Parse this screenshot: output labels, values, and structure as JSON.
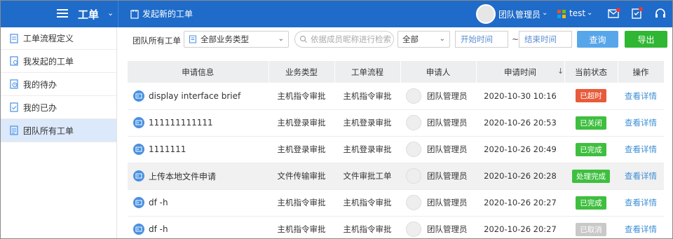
{
  "topbar": {
    "title": "工单",
    "new_ticket": "发起新的工单",
    "user_name": "团队管理员",
    "tenant_name": "test"
  },
  "colors": {
    "brand": "#1f6bc9",
    "active_side": "#dbe9fa",
    "query_button": "#58a6ea",
    "export_button": "#2fb733",
    "overtime": "#e85b3a",
    "done": "#3fbf3f",
    "cancelled": "#c9c9c9"
  },
  "sidebar": {
    "items": [
      {
        "label": "工单流程定义",
        "icon": "flow-definition-icon"
      },
      {
        "label": "我发起的工单",
        "icon": "my-ticket-icon"
      },
      {
        "label": "我的待办",
        "icon": "clock-icon"
      },
      {
        "label": "我的已办",
        "icon": "check-list-icon"
      },
      {
        "label": "团队所有工单",
        "icon": "team-ticket-icon"
      }
    ]
  },
  "filter": {
    "label": "团队所有工单",
    "business_type": "全部业务类型",
    "search_placeholder": "依据成员昵称进行检索",
    "status": "全部",
    "start_placeholder": "开始时间",
    "tilde": "~",
    "end_placeholder": "结束时间",
    "query_label": "查询",
    "export_label": "导出"
  },
  "table": {
    "headers": [
      "申请信息",
      "业务类型",
      "工单流程",
      "申请人",
      "申请时间",
      "当前状态",
      "操作"
    ],
    "sort_arrow": "↓",
    "rows": [
      {
        "info": "display interface brief",
        "type": "主机指令审批",
        "flow": "主机指令审批",
        "applicant": "团队管理员",
        "time": "2020-10-30 10:16",
        "status": "已超时",
        "status_color": "#e85b3a",
        "action": "查看详情",
        "icon": "terminal-icon"
      },
      {
        "info": "111111111111",
        "type": "主机登录审批",
        "flow": "主机登录审批",
        "applicant": "团队管理员",
        "time": "2020-10-26 20:53",
        "status": "已关闭",
        "status_color": "#3fbf3f",
        "action": "查看详情",
        "icon": "login-icon"
      },
      {
        "info": "1111111",
        "type": "主机登录审批",
        "flow": "主机登录审批",
        "applicant": "团队管理员",
        "time": "2020-10-26 20:49",
        "status": "已完成",
        "status_color": "#3fbf3f",
        "action": "查看详情",
        "icon": "login-icon"
      },
      {
        "info": "上传本地文件申请",
        "type": "文件传输审批",
        "flow": "文件审批工单",
        "applicant": "团队管理员",
        "time": "2020-10-26 20:28",
        "status": "处理完成",
        "status_color": "#3fbf3f",
        "action": "查看详情",
        "icon": "file-icon"
      },
      {
        "info": "df -h",
        "type": "主机指令审批",
        "flow": "主机指令审批",
        "applicant": "团队管理员",
        "time": "2020-10-26 20:27",
        "status": "已完成",
        "status_color": "#3fbf3f",
        "action": "查看详情",
        "icon": "terminal-icon"
      },
      {
        "info": "df -h",
        "type": "主机指令审批",
        "flow": "主机指令审批",
        "applicant": "团队管理员",
        "time": "2020-10-26 20:27",
        "status": "已取消",
        "status_color": "#c9c9c9",
        "action": "查看详情",
        "icon": "terminal-icon"
      }
    ]
  }
}
